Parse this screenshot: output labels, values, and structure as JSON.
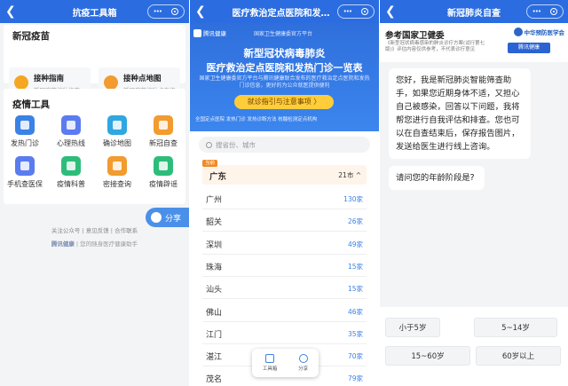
{
  "panel1": {
    "title": "抗疫工具箱",
    "vaccine_section": "新冠疫苗",
    "vaccine_cards": [
      {
        "title": "接种指南",
        "desc": "新冠疫苗接种指南",
        "icon": "question-icon"
      },
      {
        "title": "接种点地图",
        "desc": "新冠疫苗接种点查询",
        "icon": "map-pin-icon"
      }
    ],
    "tools_section": "疫情工具",
    "tools": [
      {
        "label": "发热门诊",
        "icon": "thermometer-icon",
        "color": "#3b82e6"
      },
      {
        "label": "心理热线",
        "icon": "heart-chat-icon",
        "color": "#5b7cf0"
      },
      {
        "label": "确诊地图",
        "icon": "map-location-icon",
        "color": "#2fa7e0"
      },
      {
        "label": "新冠自查",
        "icon": "self-check-icon",
        "color": "#f29b2e"
      },
      {
        "label": "手机查医保",
        "icon": "insurance-card-icon",
        "color": "#5b7cf0"
      },
      {
        "label": "疫情科普",
        "icon": "book-icon",
        "color": "#2dbd7b"
      },
      {
        "label": "密接查询",
        "icon": "contact-people-icon",
        "color": "#f29b2e"
      },
      {
        "label": "疫情辟谣",
        "icon": "rumor-icon",
        "color": "#2dbd7b"
      }
    ],
    "footer_links": "关注公众号  |  意见反馈  |  合作联系",
    "brand": "腾讯健康",
    "brand_tagline": "您的随身医疗健康助手",
    "share_label": "分享"
  },
  "panel2": {
    "title": "医疗救治定点医院和发热…",
    "logo": "腾讯健康",
    "banner_note": "国家卫生健康委官方平台",
    "headline1": "新型冠状病毒肺炎",
    "headline2": "医疗救治定点医院和发热门诊一览表",
    "desc": "国家卫生健康委官方平台与腾讯健康联合发布的医疗救治定点医院和发热门诊信息，更好的为公众就医提供便利",
    "guide_button": "就诊指引与注意事项 〉",
    "tags": "全国定点医院  发热门诊  发热诊断方法  核酸检测定点机构",
    "search_placeholder": "搜省份、城市",
    "current_tag": "当前",
    "province": "广东",
    "province_count": "21市 ^",
    "cities": [
      {
        "name": "广州",
        "count": "130家"
      },
      {
        "name": "韶关",
        "count": "26家"
      },
      {
        "name": "深圳",
        "count": "49家"
      },
      {
        "name": "珠海",
        "count": "15家"
      },
      {
        "name": "汕头",
        "count": "15家"
      },
      {
        "name": "佛山",
        "count": "46家"
      },
      {
        "name": "江门",
        "count": "35家"
      },
      {
        "name": "湛江",
        "count": "70家"
      },
      {
        "name": "茂名",
        "count": "79家"
      }
    ],
    "fab_tools": "工具箱",
    "fab_share": "分享"
  },
  "panel3": {
    "title": "新冠肺炎自查",
    "header_title": "参考国家卫健委",
    "header_desc": "《新型冠状病毒感染的肺炎诊疗方案(试行第七版)》评估内容仅供参考，不代表诊疗意见",
    "cdc": "中华预防医学会",
    "tencent": "腾讯健康",
    "bot_message": "您好，我是新冠肺炎智能筛查助手，如果您近期身体不适，又担心自己被感染，回答以下问题，我将帮您进行自我评估和排查。您也可以在自查结束后，保存报告图片，发送给医生进行线上咨询。",
    "question": "请问您的年龄阶段是?",
    "options": [
      "小于5岁",
      "5~14岁",
      "15~60岁",
      "60岁以上"
    ]
  }
}
